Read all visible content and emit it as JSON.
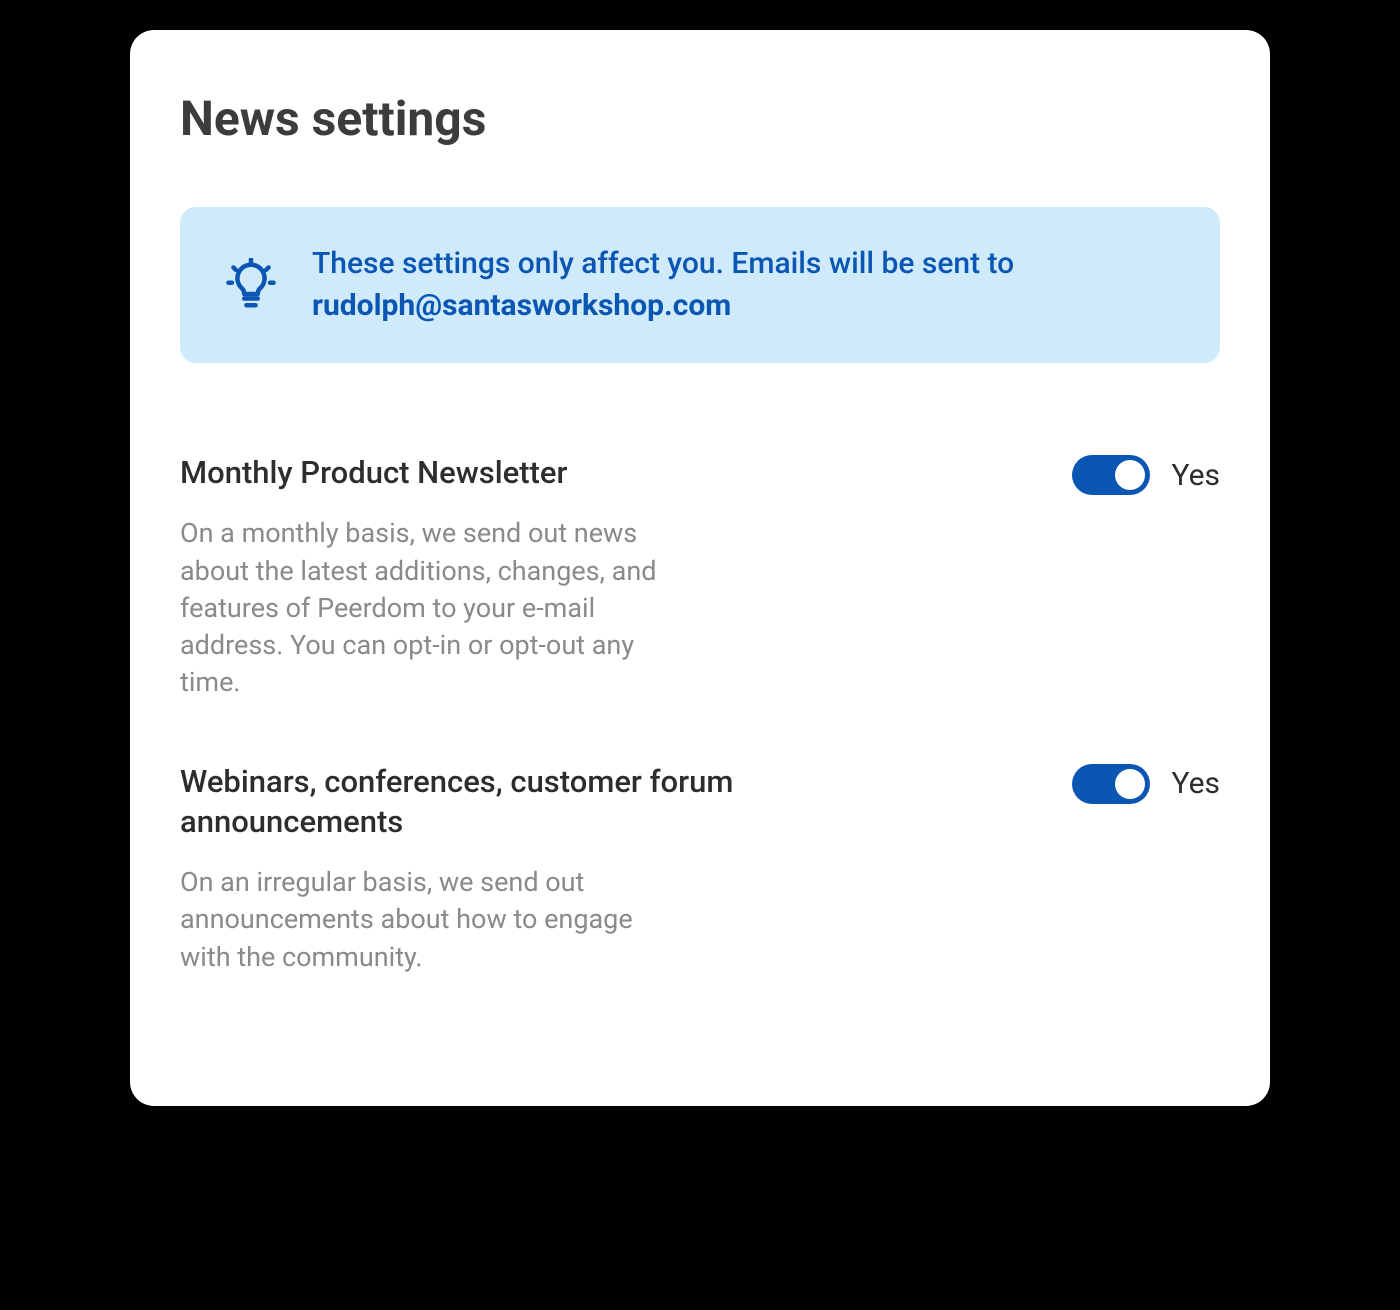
{
  "title": "News settings",
  "banner": {
    "text_prefix": "These settings only affect you. Emails will be sent to ",
    "email": "rudolph@santasworkshop.com"
  },
  "settings": {
    "newsletter": {
      "title": "Monthly Product Newsletter",
      "description": "On a monthly basis, we send out news about the latest additions, changes, and features of Peerdom to your e-mail address. You can opt-in or opt-out any time.",
      "state_label": "Yes"
    },
    "webinars": {
      "title": "Webinars, conferences, customer forum announcements",
      "description": "On an irregular basis, we send out announcements about how to engage with the community.",
      "state_label": "Yes"
    }
  }
}
